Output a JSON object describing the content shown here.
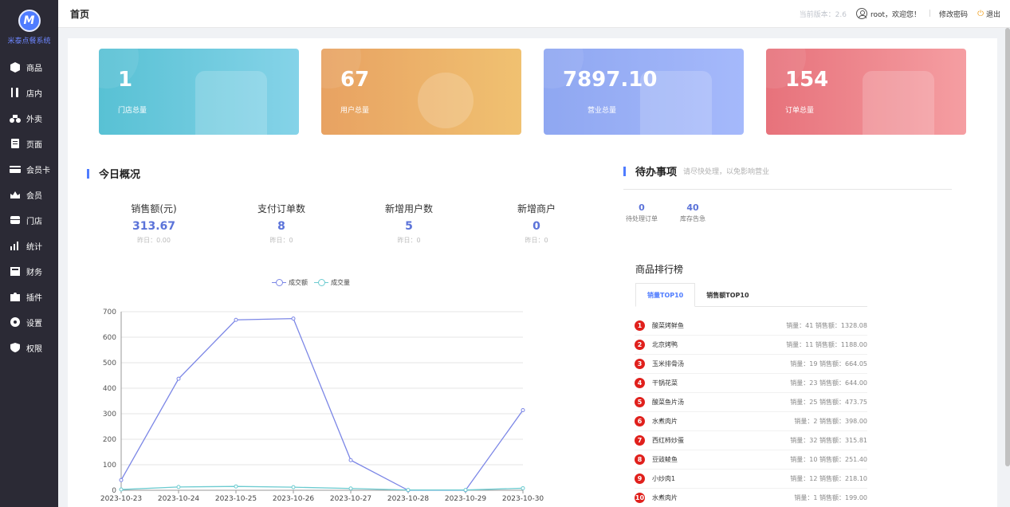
{
  "sidebar": {
    "logo_letter": "M",
    "brand": "米泰点餐系统",
    "items": [
      {
        "label": "商品",
        "icon": "box-icon"
      },
      {
        "label": "店内",
        "icon": "utensils-icon"
      },
      {
        "label": "外卖",
        "icon": "scooter-icon"
      },
      {
        "label": "页面",
        "icon": "page-icon"
      },
      {
        "label": "会员卡",
        "icon": "card-icon"
      },
      {
        "label": "会员",
        "icon": "crown-icon"
      },
      {
        "label": "门店",
        "icon": "store-icon"
      },
      {
        "label": "统计",
        "icon": "chart-icon"
      },
      {
        "label": "财务",
        "icon": "wallet-icon"
      },
      {
        "label": "插件",
        "icon": "puzzle-icon"
      },
      {
        "label": "设置",
        "icon": "gear-icon"
      },
      {
        "label": "权限",
        "icon": "shield-icon"
      }
    ]
  },
  "header": {
    "title": "首页",
    "version": "当前版本：2.6",
    "welcome": "root，欢迎您！",
    "separator": "|",
    "change_password": "修改密码",
    "logout": "退出"
  },
  "stats": [
    {
      "value": "1",
      "label": "门店总量",
      "color": "#58c1d4"
    },
    {
      "value": "67",
      "label": "用户总量",
      "color": "#e8a262"
    },
    {
      "value": "7897.10",
      "label": "营业总量",
      "color": "#8fa7f1"
    },
    {
      "value": "154",
      "label": "订单总量",
      "color": "#e7727b"
    }
  ],
  "overview": {
    "title": "今日概况",
    "items": [
      {
        "label": "销售额(元)",
        "value": "313.67",
        "yesterday": "昨日：0.00"
      },
      {
        "label": "支付订单数",
        "value": "8",
        "yesterday": "昨日：0"
      },
      {
        "label": "新增用户数",
        "value": "5",
        "yesterday": "昨日：0"
      },
      {
        "label": "新增商户",
        "value": "0",
        "yesterday": "昨日：0"
      }
    ]
  },
  "todo": {
    "title": "待办事项",
    "hint": "请尽快处理，以免影响营业",
    "items": [
      {
        "value": "0",
        "label": "待处理订单"
      },
      {
        "value": "40",
        "label": "库存告急"
      }
    ]
  },
  "ranking": {
    "title": "商品排行榜",
    "tabs": [
      "销量TOP10",
      "销售额TOP10"
    ],
    "rows": [
      {
        "rank": "1",
        "name": "酸菜烤鲜鱼",
        "stat": "销量：41 销售额：1328.08"
      },
      {
        "rank": "2",
        "name": "北京烤鸭",
        "stat": "销量：11 销售额：1188.00"
      },
      {
        "rank": "3",
        "name": "玉米排骨汤",
        "stat": "销量：19 销售额：664.05"
      },
      {
        "rank": "4",
        "name": "干锅花菜",
        "stat": "销量：23 销售额：644.00"
      },
      {
        "rank": "5",
        "name": "酸菜鱼片汤",
        "stat": "销量：25 销售额：473.75"
      },
      {
        "rank": "6",
        "name": "水煮肉片",
        "stat": "销量：2 销售额：398.00"
      },
      {
        "rank": "7",
        "name": "西红柿炒蛋",
        "stat": "销量：32 销售额：315.81"
      },
      {
        "rank": "8",
        "name": "豆豉鲮鱼",
        "stat": "销量：10 销售额：251.40"
      },
      {
        "rank": "9",
        "name": "小炒肉1",
        "stat": "销量：12 销售额：218.10"
      },
      {
        "rank": "10",
        "name": "水煮肉片",
        "stat": "销量：1 销售额：199.00"
      }
    ]
  },
  "colors": {
    "accent": "#4f7cff",
    "series_amount": "#7b86e6",
    "series_count": "#6ccbd0",
    "rank_badge": "#e0201c"
  },
  "chart_data": {
    "type": "line",
    "x": [
      "2023-10-23",
      "2023-10-24",
      "2023-10-25",
      "2023-10-26",
      "2023-10-27",
      "2023-10-28",
      "2023-10-29",
      "2023-10-30"
    ],
    "series": [
      {
        "name": "成交额",
        "values": [
          40,
          437,
          668,
          673,
          118,
          0,
          0,
          314
        ]
      },
      {
        "name": "成交量",
        "values": [
          3,
          13,
          15,
          12,
          7,
          1,
          1,
          8
        ]
      }
    ],
    "yticks": [
      "0",
      "100",
      "200",
      "300",
      "400",
      "500",
      "600",
      "700"
    ],
    "ylim": [
      0,
      700
    ],
    "grid": true,
    "legend": "top"
  }
}
